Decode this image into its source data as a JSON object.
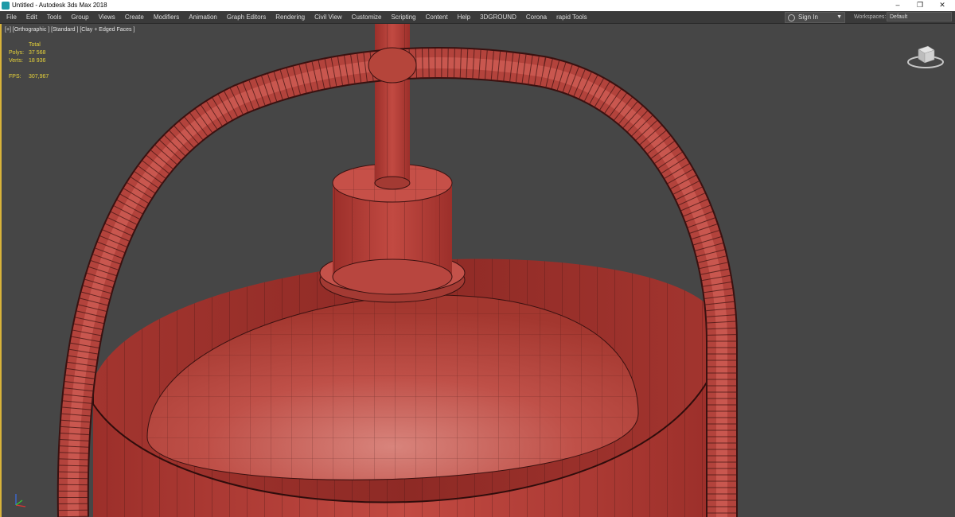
{
  "window": {
    "title": "Untitled - Autodesk 3ds Max 2018",
    "controls": [
      "–",
      "❐",
      "✕"
    ]
  },
  "menu": [
    "File",
    "Edit",
    "Tools",
    "Group",
    "Views",
    "Create",
    "Modifiers",
    "Animation",
    "Graph Editors",
    "Rendering",
    "Civil View",
    "Customize",
    "Scripting",
    "Content",
    "Help",
    "3DGROUND",
    "Corona",
    "rapid Tools"
  ],
  "account": {
    "sign_in": "Sign In",
    "workspaces_label": "Workspaces:",
    "workspace": "Default"
  },
  "viewport": {
    "label": "[+] [Orthographic ] [Standard ] [Clay + Edged Faces ]",
    "stats": {
      "header": "Total",
      "polys_label": "Polys:",
      "polys_value": "37 568",
      "verts_label": "Verts:",
      "verts_value": "18 936",
      "fps_label": "FPS:",
      "fps_value": "307,967"
    },
    "background_color": "#464646",
    "model_color": "#b5453b",
    "border_accent": "#d8b33a"
  },
  "icons": {
    "app": "3ds-max-icon",
    "viewcube": "viewcube-icon",
    "axis": "axis-tripod-icon",
    "user": "user-icon"
  }
}
